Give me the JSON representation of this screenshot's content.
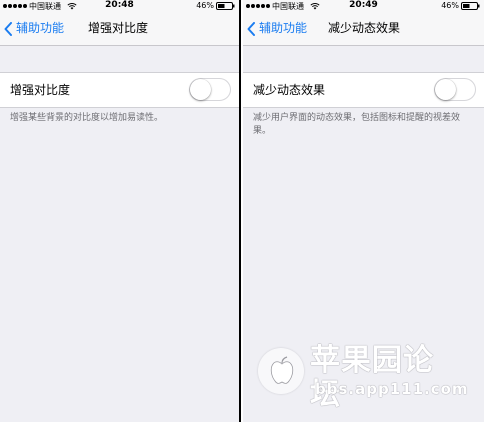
{
  "left": {
    "status": {
      "carrier": "中国联通",
      "time": "20:48",
      "battery": "46%"
    },
    "nav": {
      "back_label": "辅助功能",
      "title": "增强对比度"
    },
    "setting": {
      "label": "增强对比度",
      "enabled": false
    },
    "footnote": "增强某些背景的对比度以增加易读性。"
  },
  "right": {
    "status": {
      "carrier": "中国联通",
      "time": "20:49",
      "battery": "46%"
    },
    "nav": {
      "back_label": "辅助功能",
      "title": "减少动态效果"
    },
    "setting": {
      "label": "减少动态效果",
      "enabled": false
    },
    "footnote": "减少用户界面的动态效果，包括图标和提醒的视差效果。"
  },
  "watermark": {
    "cn": "苹果园论坛",
    "url": "bbs.app111.com"
  },
  "colors": {
    "accent": "#1a7cf0",
    "background": "#efeff4",
    "footnote": "#6d6d72"
  },
  "icons": [
    "signal-dots-icon",
    "wifi-icon",
    "battery-icon",
    "chevron-left-icon",
    "apple-logo-icon"
  ]
}
